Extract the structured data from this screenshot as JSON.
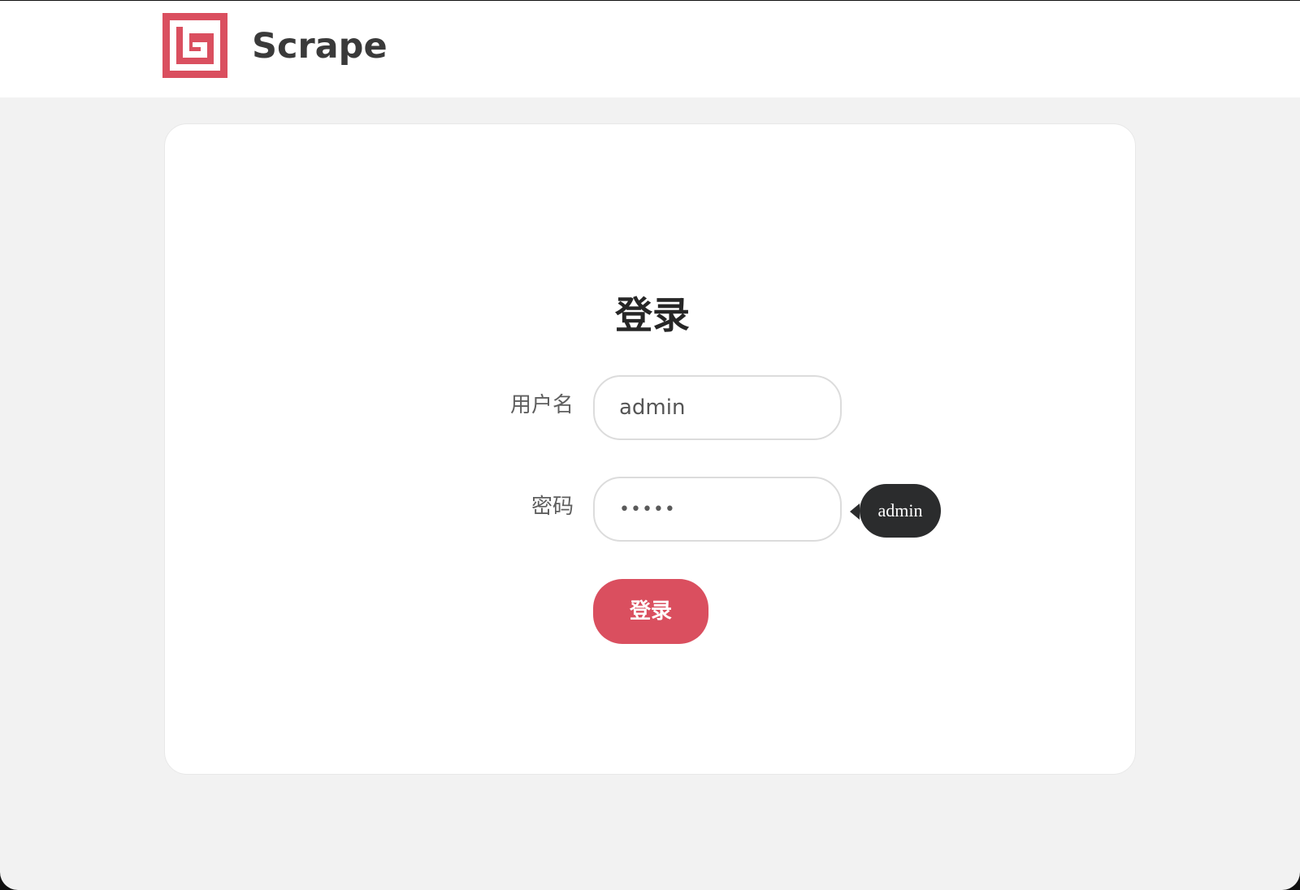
{
  "header": {
    "brand": "Scrape",
    "logo_icon": "scrape-logo-icon",
    "logo_color": "#da4f5f"
  },
  "login": {
    "title": "登录",
    "username_label": "用户名",
    "username_value": "admin",
    "password_label": "密码",
    "password_value": "•••••",
    "tooltip_text": "admin",
    "submit_label": "登录"
  },
  "colors": {
    "accent": "#da4f5f",
    "background": "#f2f2f2",
    "tooltip": "#2b2c2d"
  }
}
